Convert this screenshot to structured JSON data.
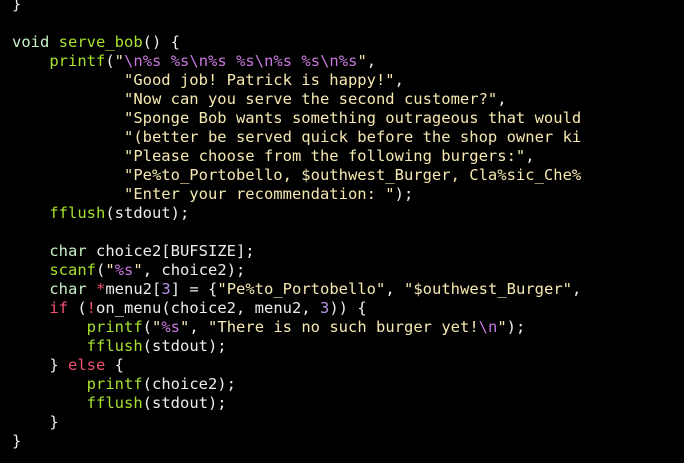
{
  "editor": {
    "language": "c",
    "colors": {
      "background": "#000000",
      "text": "#ededed",
      "keyword": "#c7f2c7",
      "function": "#a6e22e",
      "string": "#f5e8b0",
      "escape": "#c678dd",
      "number": "#b793e6",
      "control": "#f0526f"
    },
    "lines": [
      [
        {
          "t": "}",
          "c": "w"
        }
      ],
      [],
      [
        {
          "t": "void",
          "c": "kw"
        },
        {
          "t": " ",
          "c": "w"
        },
        {
          "t": "serve_bob",
          "c": "fn"
        },
        {
          "t": "() {",
          "c": "w"
        }
      ],
      [
        {
          "t": "    ",
          "c": "w"
        },
        {
          "t": "printf",
          "c": "fn"
        },
        {
          "t": "(",
          "c": "w"
        },
        {
          "t": "\"",
          "c": "str"
        },
        {
          "t": "\\n",
          "c": "esc"
        },
        {
          "t": "%s",
          "c": "esc"
        },
        {
          "t": " ",
          "c": "str"
        },
        {
          "t": "%s",
          "c": "esc"
        },
        {
          "t": "\\n",
          "c": "esc"
        },
        {
          "t": "%s",
          "c": "esc"
        },
        {
          "t": " ",
          "c": "str"
        },
        {
          "t": "%s",
          "c": "esc"
        },
        {
          "t": "\\n",
          "c": "esc"
        },
        {
          "t": "%s",
          "c": "esc"
        },
        {
          "t": " ",
          "c": "str"
        },
        {
          "t": "%s",
          "c": "esc"
        },
        {
          "t": "\\n",
          "c": "esc"
        },
        {
          "t": "%s",
          "c": "esc"
        },
        {
          "t": "\"",
          "c": "str"
        },
        {
          "t": ",",
          "c": "w"
        }
      ],
      [
        {
          "t": "            ",
          "c": "w"
        },
        {
          "t": "\"Good job! Patrick is happy!\"",
          "c": "str"
        },
        {
          "t": ",",
          "c": "w"
        }
      ],
      [
        {
          "t": "            ",
          "c": "w"
        },
        {
          "t": "\"Now can you serve the second customer?\"",
          "c": "str"
        },
        {
          "t": ",",
          "c": "w"
        }
      ],
      [
        {
          "t": "            ",
          "c": "w"
        },
        {
          "t": "\"Sponge Bob wants something outrageous that would",
          "c": "str"
        }
      ],
      [
        {
          "t": "            ",
          "c": "w"
        },
        {
          "t": "\"(better be served quick before the shop owner ki",
          "c": "str"
        }
      ],
      [
        {
          "t": "            ",
          "c": "w"
        },
        {
          "t": "\"Please choose from the following burgers:\"",
          "c": "str"
        },
        {
          "t": ",",
          "c": "w"
        }
      ],
      [
        {
          "t": "            ",
          "c": "w"
        },
        {
          "t": "\"Pe%to_Portobello, $outhwest_Burger, Cla%sic_Che%",
          "c": "str"
        }
      ],
      [
        {
          "t": "            ",
          "c": "w"
        },
        {
          "t": "\"Enter your recommendation: \"",
          "c": "str"
        },
        {
          "t": ");",
          "c": "w"
        }
      ],
      [
        {
          "t": "    ",
          "c": "w"
        },
        {
          "t": "fflush",
          "c": "fn"
        },
        {
          "t": "(stdout);",
          "c": "w"
        }
      ],
      [],
      [
        {
          "t": "    ",
          "c": "w"
        },
        {
          "t": "char",
          "c": "kw"
        },
        {
          "t": " choice2[BUFSIZE];",
          "c": "w"
        }
      ],
      [
        {
          "t": "    ",
          "c": "w"
        },
        {
          "t": "scanf",
          "c": "fn"
        },
        {
          "t": "(",
          "c": "w"
        },
        {
          "t": "\"",
          "c": "str"
        },
        {
          "t": "%s",
          "c": "esc"
        },
        {
          "t": "\"",
          "c": "str"
        },
        {
          "t": ", choice2);",
          "c": "w"
        }
      ],
      [
        {
          "t": "    ",
          "c": "w"
        },
        {
          "t": "char",
          "c": "kw"
        },
        {
          "t": " ",
          "c": "w"
        },
        {
          "t": "*",
          "c": "ctl"
        },
        {
          "t": "menu2[",
          "c": "w"
        },
        {
          "t": "3",
          "c": "num"
        },
        {
          "t": "] = {",
          "c": "w"
        },
        {
          "t": "\"Pe%to_Portobello\"",
          "c": "str"
        },
        {
          "t": ", ",
          "c": "w"
        },
        {
          "t": "\"$outhwest_Burger\"",
          "c": "str"
        },
        {
          "t": ",",
          "c": "w"
        }
      ],
      [
        {
          "t": "    ",
          "c": "w"
        },
        {
          "t": "if",
          "c": "ctl"
        },
        {
          "t": " (",
          "c": "w"
        },
        {
          "t": "!",
          "c": "ctl"
        },
        {
          "t": "on_menu(choice2, menu2, ",
          "c": "w"
        },
        {
          "t": "3",
          "c": "num"
        },
        {
          "t": ")) {",
          "c": "w"
        }
      ],
      [
        {
          "t": "        ",
          "c": "w"
        },
        {
          "t": "printf",
          "c": "fn"
        },
        {
          "t": "(",
          "c": "w"
        },
        {
          "t": "\"",
          "c": "str"
        },
        {
          "t": "%s",
          "c": "esc"
        },
        {
          "t": "\"",
          "c": "str"
        },
        {
          "t": ", ",
          "c": "w"
        },
        {
          "t": "\"There is no such burger yet!",
          "c": "str"
        },
        {
          "t": "\\n",
          "c": "esc"
        },
        {
          "t": "\"",
          "c": "str"
        },
        {
          "t": ");",
          "c": "w"
        }
      ],
      [
        {
          "t": "        ",
          "c": "w"
        },
        {
          "t": "fflush",
          "c": "fn"
        },
        {
          "t": "(stdout);",
          "c": "w"
        }
      ],
      [
        {
          "t": "    } ",
          "c": "w"
        },
        {
          "t": "else",
          "c": "ctl"
        },
        {
          "t": " {",
          "c": "w"
        }
      ],
      [
        {
          "t": "        ",
          "c": "w"
        },
        {
          "t": "printf",
          "c": "fn"
        },
        {
          "t": "(choice2);",
          "c": "w"
        }
      ],
      [
        {
          "t": "        ",
          "c": "w"
        },
        {
          "t": "fflush",
          "c": "fn"
        },
        {
          "t": "(stdout);",
          "c": "w"
        }
      ],
      [
        {
          "t": "    }",
          "c": "w"
        }
      ],
      [
        {
          "t": "}",
          "c": "w"
        }
      ]
    ]
  }
}
